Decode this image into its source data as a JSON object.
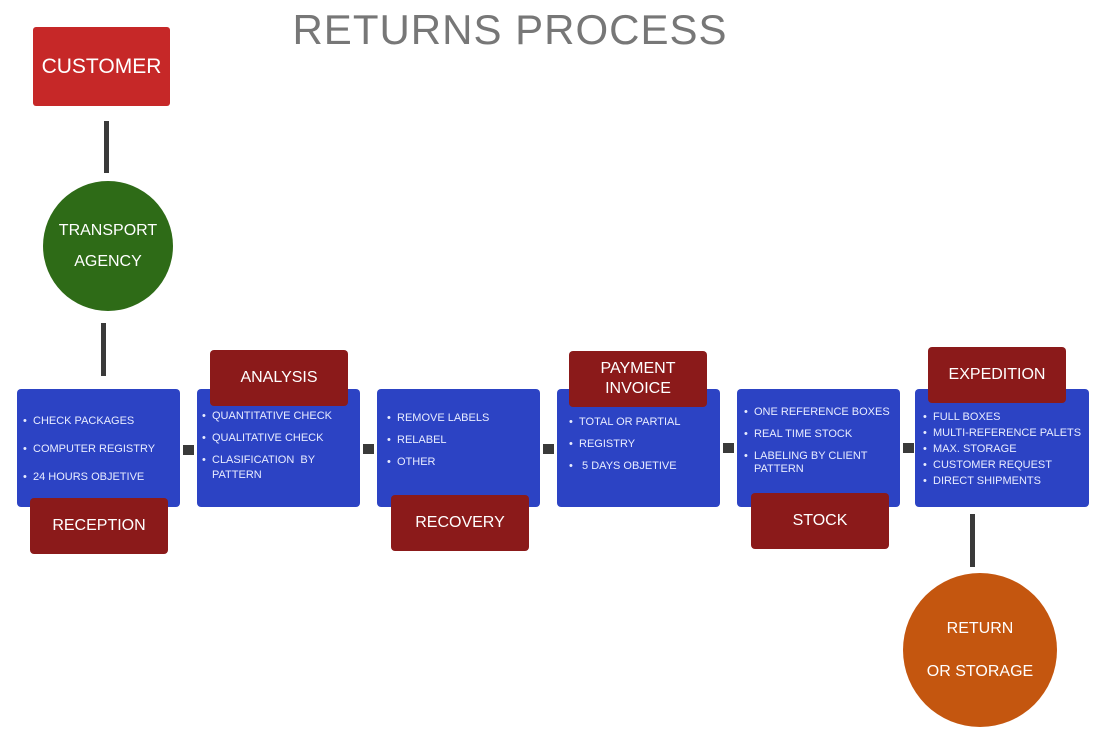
{
  "title": "RETURNS PROCESS",
  "customer": "CUSTOMER",
  "transport": [
    "TRANSPORT",
    "AGENCY"
  ],
  "final": [
    "RETURN",
    "OR STORAGE"
  ],
  "colors": {
    "customer": "#c62828",
    "transport": "#2e6b17",
    "final": "#c4560f",
    "box": "#2c43c4",
    "label": "#8b1a1a",
    "connector": "#3a3a3a"
  },
  "stages": [
    {
      "label": "RECEPTION",
      "items": [
        "CHECK PACKAGES",
        "COMPUTER REGISTRY",
        "24 HOURS OBJETIVE"
      ]
    },
    {
      "label": "ANALYSIS",
      "items": [
        "QUANTITATIVE CHECK",
        "QUALITATIVE CHECK",
        "CLASIFICATION  BY PATTERN"
      ]
    },
    {
      "label": "RECOVERY",
      "items": [
        "REMOVE LABELS",
        "RELABEL",
        "OTHER"
      ]
    },
    {
      "label": "PAYMENT INVOICE",
      "items": [
        "TOTAL OR PARTIAL",
        "REGISTRY",
        " 5 DAYS OBJETIVE"
      ]
    },
    {
      "label": "STOCK",
      "items": [
        "ONE REFERENCE BOXES",
        "REAL TIME STOCK",
        "LABELING BY CLIENT PATTERN"
      ]
    },
    {
      "label": "EXPEDITION",
      "items": [
        "FULL BOXES",
        "MULTI-REFERENCE PALETS",
        "MAX. STORAGE",
        "CUSTOMER REQUEST",
        "DIRECT SHIPMENTS"
      ]
    }
  ]
}
